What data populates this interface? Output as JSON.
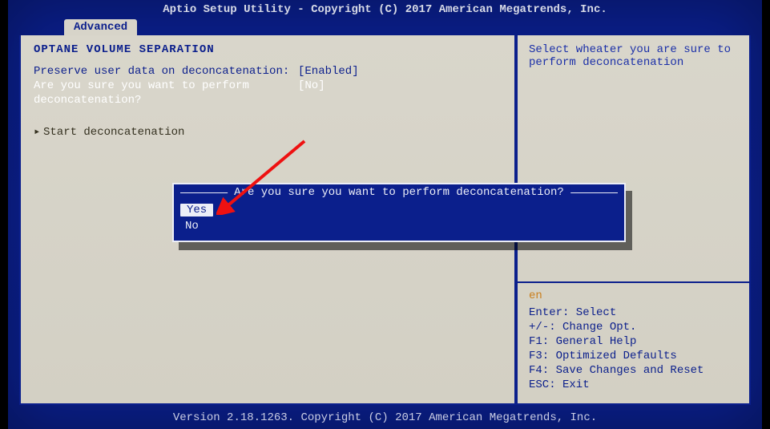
{
  "titlebar": "Aptio Setup Utility - Copyright (C) 2017 American Megatrends, Inc.",
  "tab": "Advanced",
  "section_title": "OPTANE VOLUME SEPARATION",
  "row1": {
    "label": "Preserve user data on deconcatenation:",
    "value": "[Enabled]"
  },
  "row2": {
    "label": "Are you sure you want to perform deconcatenation?",
    "value": "[No]"
  },
  "action": "Start deconcatenation",
  "help_top": "Select wheater you are sure to perform deconcatenation",
  "help_screen_token": "en",
  "keys": {
    "enter": "Enter: Select",
    "opt": "+/-: Change Opt.",
    "f1": "F1: General Help",
    "f3": "F3: Optimized Defaults",
    "f4": "F4: Save Changes and Reset",
    "esc": "ESC: Exit"
  },
  "popup": {
    "title": "Are you sure you want to perform deconcatenation?",
    "yes": "Yes",
    "no": "No"
  },
  "footer": "Version 2.18.1263. Copyright (C) 2017 American Megatrends, Inc."
}
